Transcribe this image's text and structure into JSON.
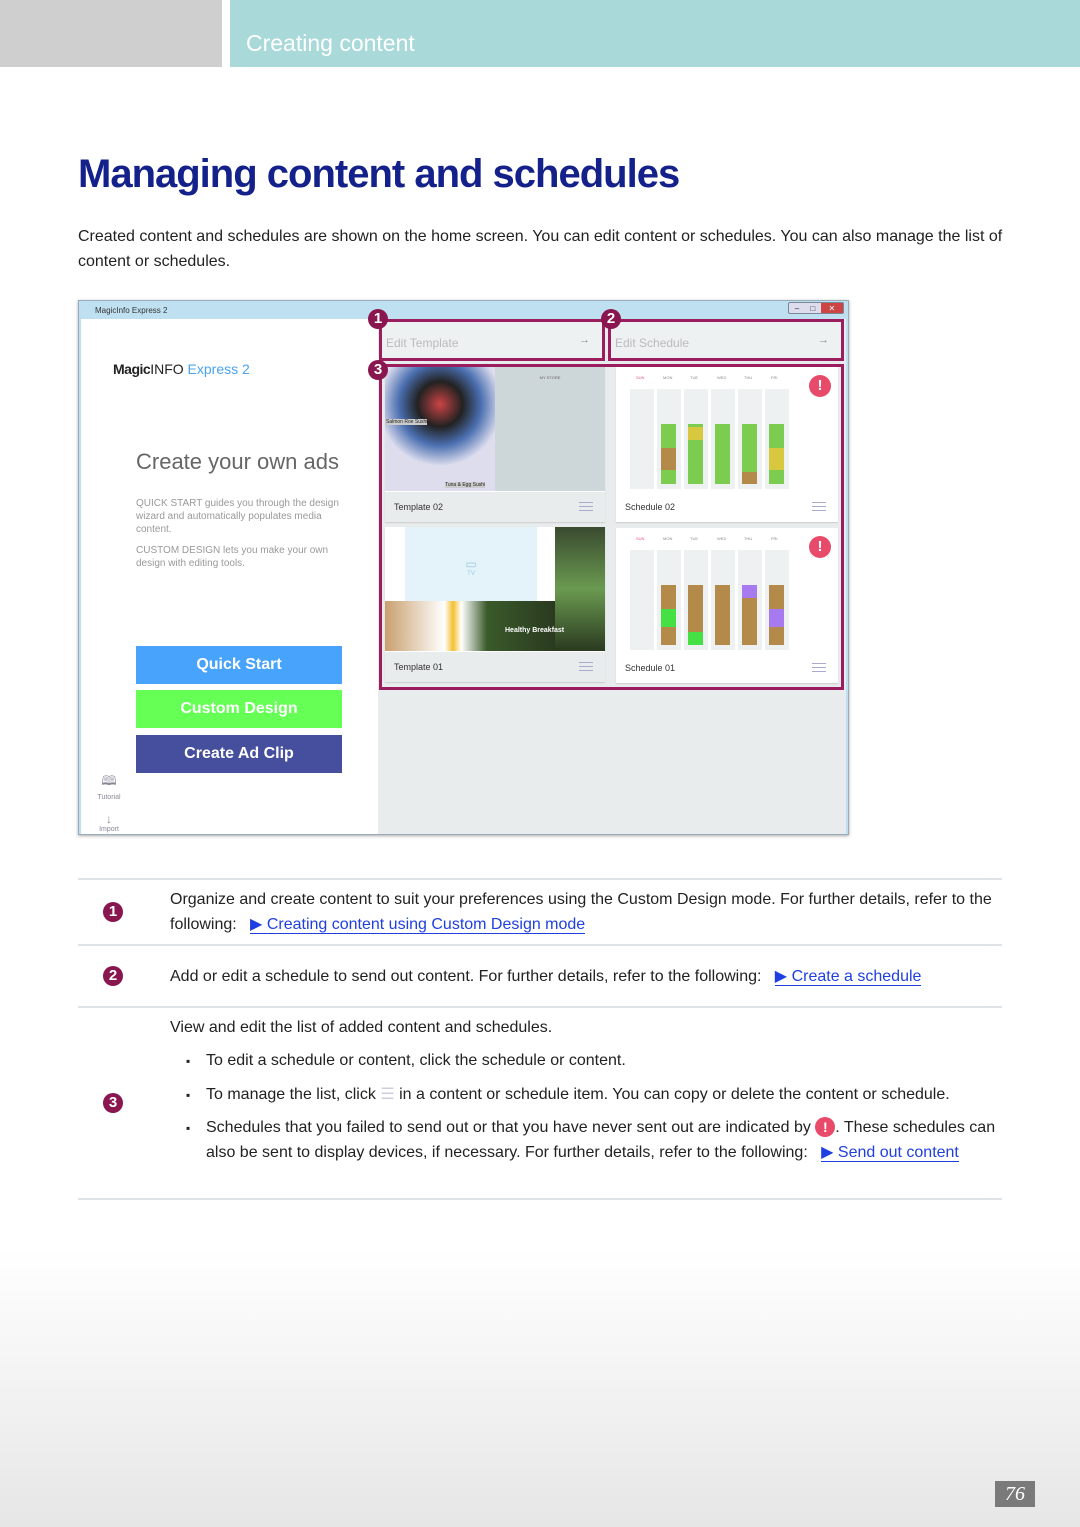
{
  "header": {
    "section": "Creating content"
  },
  "title": "Managing content and schedules",
  "intro": "Created content and schedules are shown on the home screen. You can edit content or schedules. You can also manage the list of content or schedules.",
  "screenshot": {
    "window_title": "MagicInfo Express 2",
    "logo": {
      "magic": "Magic",
      "info": "INFO",
      "express": "Express 2"
    },
    "headline": "Create your own ads",
    "desc1": "QUICK START guides you through the design wizard and automatically populates media content.",
    "desc2": "CUSTOM DESIGN lets you make your own design with editing tools.",
    "buttons": [
      {
        "label": "Quick Start",
        "color": "#47a3fb"
      },
      {
        "label": "Custom Design",
        "color": "#66ff55"
      },
      {
        "label": "Create Ad Clip",
        "color": "#464e9e"
      }
    ],
    "side": [
      {
        "label": "Tutorial",
        "icon": "book-icon"
      },
      {
        "label": "Import",
        "icon": "download-icon"
      }
    ],
    "edit_template": "Edit Template",
    "edit_schedule": "Edit Schedule",
    "template02": {
      "name": "Template 02",
      "caption1": "Salmon Roe Sushi",
      "caption2": "Tuna & Egg Sushi",
      "store": "MY STORE"
    },
    "template01": {
      "name": "Template 01",
      "tv": "TV",
      "caption": "Healthy Breakfast"
    },
    "days": [
      "SUN",
      "MON",
      "TUE",
      "WED",
      "THU",
      "FRI"
    ],
    "schedule02": {
      "name": "Schedule 02",
      "bars": [
        [],
        [
          [
            "#7ccc50",
            40
          ],
          [
            "#b48a4a",
            36
          ],
          [
            "#7ccc50",
            24
          ]
        ],
        [
          [
            "#7ccc50",
            5
          ],
          [
            "#d8c840",
            22
          ],
          [
            "#7ccc50",
            73
          ]
        ],
        [
          [
            "#7ccc50",
            100
          ]
        ],
        [
          [
            "#7ccc50",
            80
          ],
          [
            "#b48a4a",
            20
          ]
        ],
        [
          [
            "#7ccc50",
            40
          ],
          [
            "#d8c840",
            36
          ],
          [
            "#7ccc50",
            24
          ]
        ]
      ]
    },
    "schedule01": {
      "name": "Schedule 01",
      "bars": [
        [],
        [
          [
            "#b48a4a",
            40
          ],
          [
            "#44e044",
            30
          ],
          [
            "#b48a4a",
            30
          ]
        ],
        [
          [
            "#b48a4a",
            79
          ],
          [
            "#44e044",
            21
          ]
        ],
        [
          [
            "#b48a4a",
            100
          ]
        ],
        [
          [
            "#a87af0",
            21
          ],
          [
            "#b48a4a",
            79
          ]
        ],
        [
          [
            "#b48a4a",
            40
          ],
          [
            "#a87af0",
            30
          ],
          [
            "#b48a4a",
            30
          ]
        ]
      ]
    },
    "alert": "!"
  },
  "rows": [
    {
      "num": "1",
      "text": "Organize and create content to suit your preferences using the Custom Design mode. For further details, refer to the following:",
      "link": "Creating content using Custom Design mode"
    },
    {
      "num": "2",
      "text": "Add or edit a schedule to send out content. For further details, refer to the following:",
      "link": "Create a schedule"
    },
    {
      "num": "3",
      "text": "View and edit the list of added content and schedules.",
      "b1": "To edit a schedule or content, click the schedule or content.",
      "b2a": "To manage the list, click",
      "b2b": "in a content or schedule item. You can copy or delete the content or schedule.",
      "b3a": "Schedules that you failed to send out or that you have never sent out are indicated by",
      "b3b": ". These schedules can also be sent to display devices, if necessary. For further details, refer to the following:",
      "link": "Send out content"
    }
  ],
  "page_number": "76",
  "link_arrow": "▶"
}
